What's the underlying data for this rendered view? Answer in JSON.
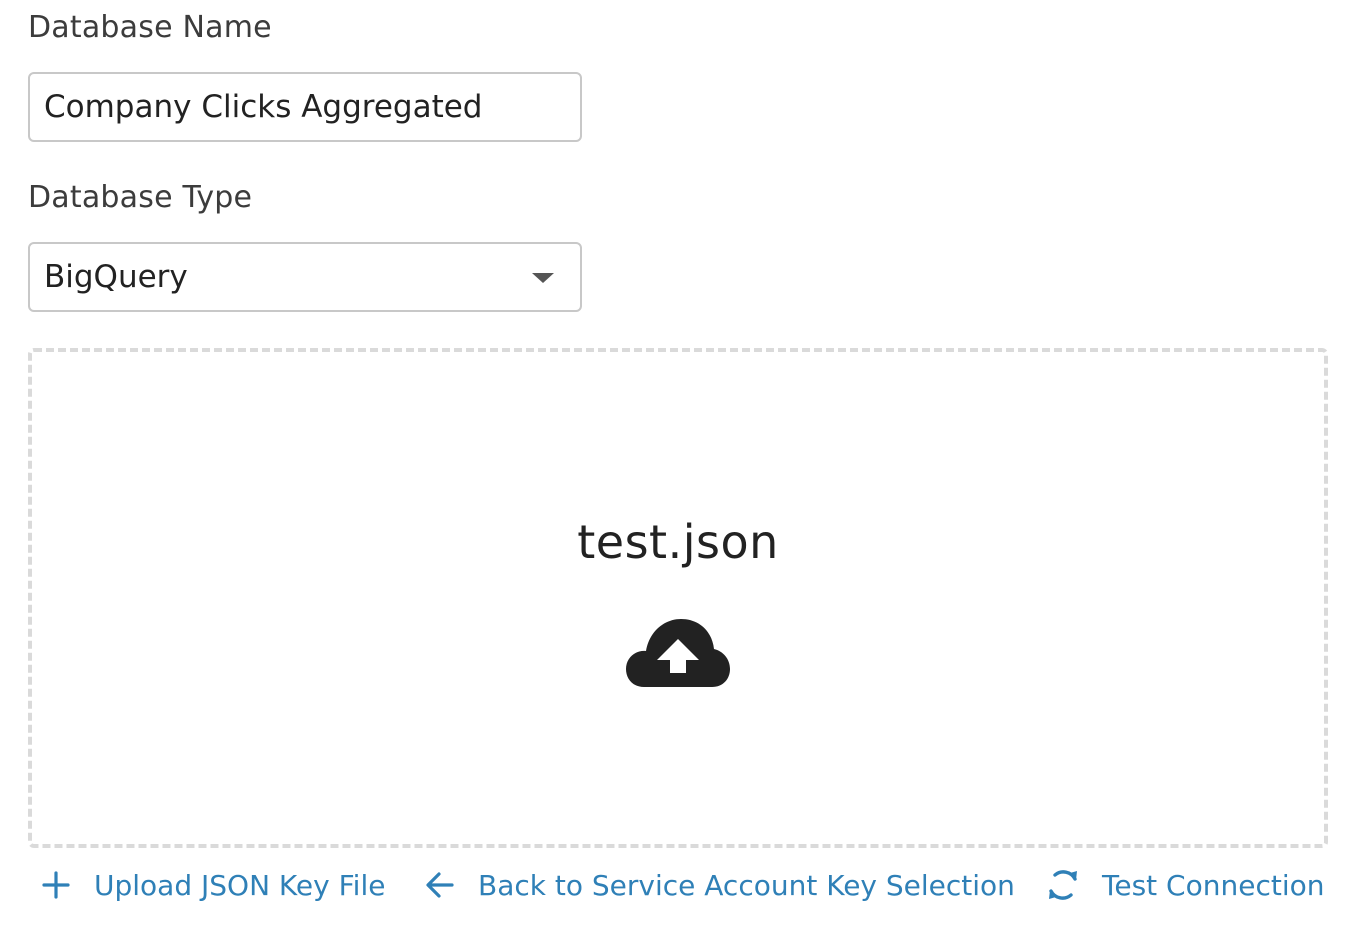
{
  "form": {
    "name_label": "Database Name",
    "name_value": "Company Clicks Aggregated",
    "type_label": "Database Type",
    "type_value": "BigQuery"
  },
  "dropzone": {
    "file_name": "test.json",
    "icon": "cloud-upload-icon"
  },
  "actions": {
    "upload_label": "Upload JSON Key File",
    "upload_icon": "plus-icon",
    "back_label": "Back to Service Account Key Selection",
    "back_icon": "arrow-left-icon",
    "test_label": "Test Connection",
    "test_icon": "refresh-icon"
  },
  "colors": {
    "link": "#2f80b7",
    "border": "#c8c8c8",
    "dash": "#dadada",
    "text": "#222222"
  }
}
